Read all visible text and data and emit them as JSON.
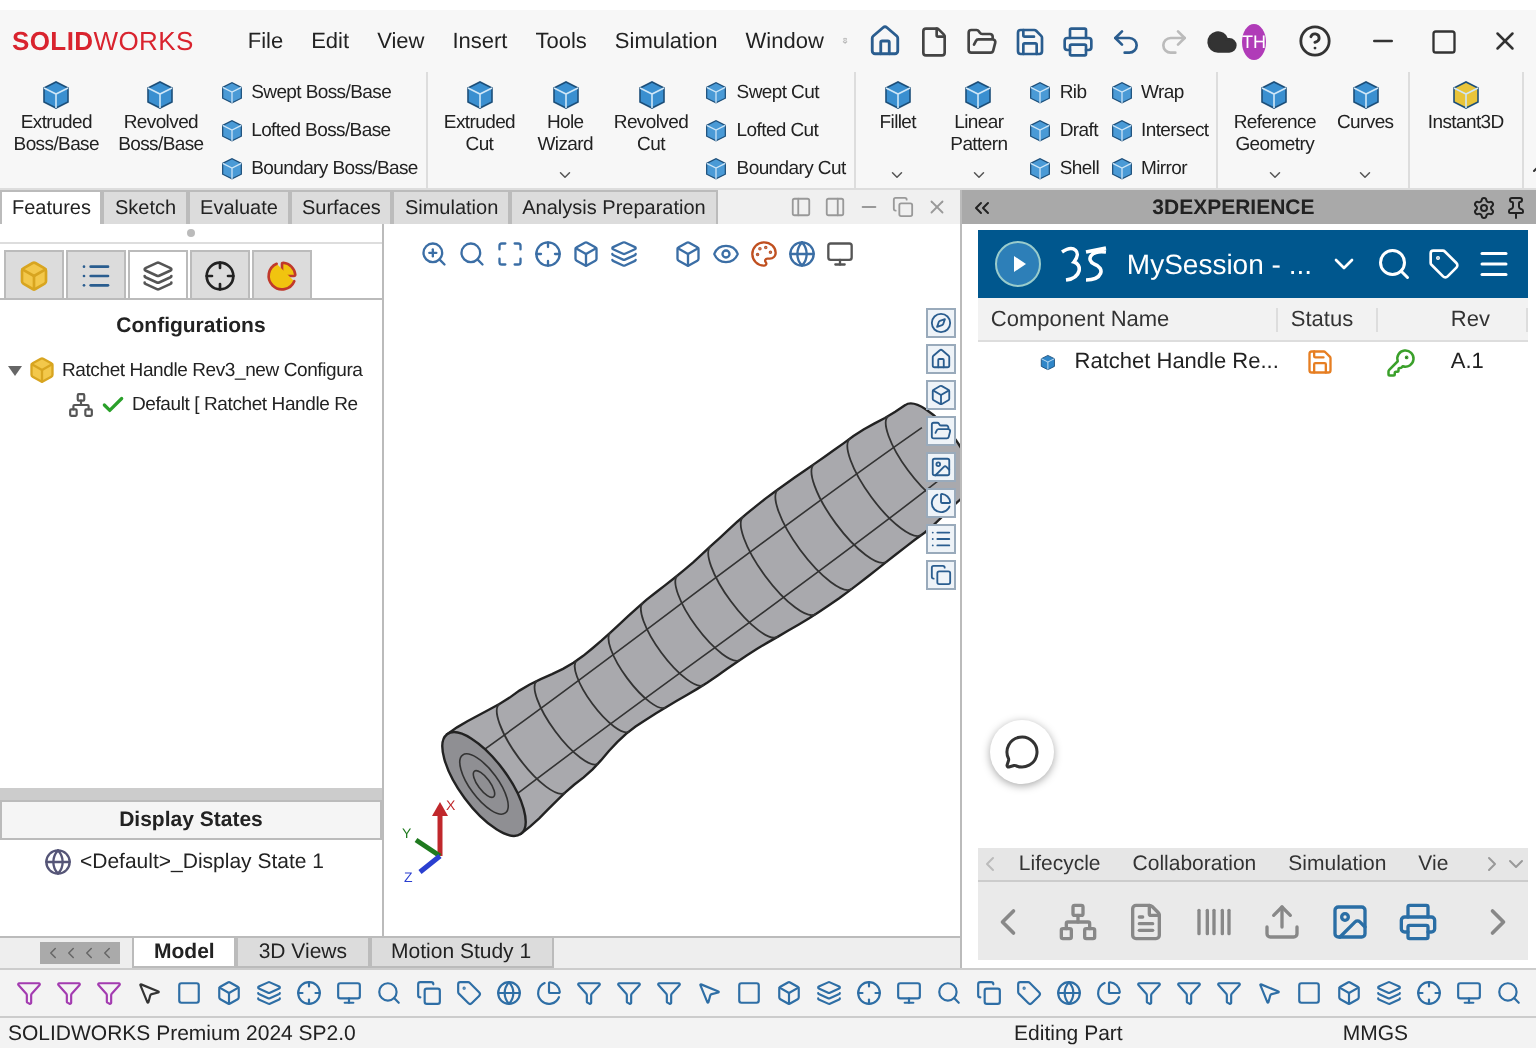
{
  "app": {
    "logo": "**SOLID**WORKS",
    "user_initials": "TH"
  },
  "menu": [
    "File",
    "Edit",
    "View",
    "Insert",
    "Tools",
    "Simulation",
    "Window"
  ],
  "ribbon": {
    "groups": [
      {
        "items": [
          {
            "kind": "large",
            "label": "Extruded Boss/Base",
            "dropdown": false
          },
          {
            "kind": "large",
            "label": "Revolved Boss/Base",
            "dropdown": false
          },
          {
            "kind": "stack",
            "items": [
              "Swept Boss/Base",
              "Lofted Boss/Base",
              "Boundary Boss/Base"
            ]
          }
        ]
      },
      {
        "items": [
          {
            "kind": "large",
            "label": "Extruded Cut",
            "dropdown": false
          },
          {
            "kind": "large",
            "label": "Hole Wizard",
            "dropdown": true
          },
          {
            "kind": "large",
            "label": "Revolved Cut",
            "dropdown": false
          },
          {
            "kind": "stack",
            "items": [
              "Swept Cut",
              "Lofted Cut",
              "Boundary Cut"
            ]
          }
        ]
      },
      {
        "items": [
          {
            "kind": "large",
            "label": "Fillet",
            "dropdown": true
          },
          {
            "kind": "large",
            "label": "Linear Pattern",
            "dropdown": true
          },
          {
            "kind": "stack",
            "items": [
              "Rib",
              "Draft",
              "Shell"
            ]
          },
          {
            "kind": "stack",
            "items": [
              "Wrap",
              "Intersect",
              "Mirror"
            ]
          }
        ]
      },
      {
        "items": [
          {
            "kind": "large",
            "label": "Reference Geometry",
            "dropdown": true
          },
          {
            "kind": "large",
            "label": "Curves",
            "dropdown": true
          }
        ]
      },
      {
        "items": [
          {
            "kind": "large",
            "label": "Instant3D",
            "dropdown": false
          }
        ]
      }
    ]
  },
  "tabs": [
    {
      "label": "Features",
      "selected": true
    },
    {
      "label": "Sketch",
      "selected": false
    },
    {
      "label": "Evaluate",
      "selected": false
    },
    {
      "label": "Surfaces",
      "selected": false
    },
    {
      "label": "Simulation",
      "selected": false
    },
    {
      "label": "Analysis Preparation",
      "selected": false
    }
  ],
  "left_panel": {
    "tabs": [
      {
        "kind": "feature",
        "selected": false
      },
      {
        "kind": "property",
        "selected": false
      },
      {
        "kind": "configuration",
        "selected": true
      },
      {
        "kind": "dimxpert",
        "selected": false
      },
      {
        "kind": "display",
        "selected": false
      }
    ],
    "title": "Configurations",
    "tree": [
      {
        "label": "Ratchet Handle Rev3_new Configura",
        "expanded": true,
        "children": [
          {
            "label": "Default [ Ratchet Handle Re",
            "active": true
          }
        ]
      }
    ],
    "display_states": {
      "title": "Display States",
      "items": [
        "<Default>_Display State 1"
      ]
    }
  },
  "viewport": {
    "triad": {
      "x": "X",
      "y": "Y",
      "z": "Z"
    }
  },
  "right_panel": {
    "title": "3DEXPERIENCE",
    "session": "MySession - ...",
    "columns": [
      "Component Name",
      "Status",
      "Rev"
    ],
    "rows": [
      {
        "name": "Ratchet Handle Re...",
        "rev": "A.1"
      }
    ],
    "tabs": [
      {
        "label": "Lifecycle",
        "selected": false
      },
      {
        "label": "Collaboration",
        "selected": false
      },
      {
        "label": "Simulation",
        "selected": false
      },
      {
        "label": "Vie",
        "selected": false
      }
    ]
  },
  "bottom_tabs": [
    {
      "label": "Model",
      "selected": true
    },
    {
      "label": "3D Views",
      "selected": false
    },
    {
      "label": "Motion Study 1",
      "selected": false
    }
  ],
  "status_bar": {
    "product": "SOLIDWORKS Premium 2024 SP2.0",
    "mode": "Editing Part",
    "units": "MMGS"
  }
}
